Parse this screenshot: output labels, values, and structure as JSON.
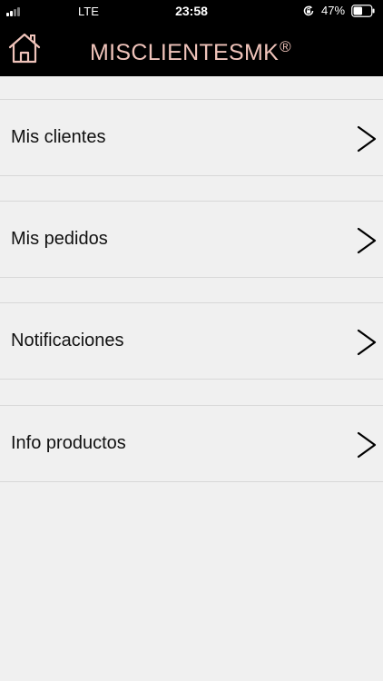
{
  "status_bar": {
    "network": "LTE",
    "time": "23:58",
    "battery_percent": "47%",
    "icons": [
      "signal-icon",
      "orientation-lock-icon",
      "battery-icon"
    ]
  },
  "header": {
    "home_icon": "home-icon",
    "title": "MISCLIENTESMK",
    "title_mark": "®",
    "title_color": "#efc3ba"
  },
  "menu": {
    "items": [
      {
        "label": "Mis clientes",
        "icon": "chevron-right-icon"
      },
      {
        "label": "Mis pedidos",
        "icon": "chevron-right-icon"
      },
      {
        "label": "Notificaciones",
        "icon": "chevron-right-icon"
      },
      {
        "label": "Info productos",
        "icon": "chevron-right-icon"
      }
    ]
  },
  "colors": {
    "bar_background": "#000000",
    "page_background": "#f0f0f0"
  }
}
